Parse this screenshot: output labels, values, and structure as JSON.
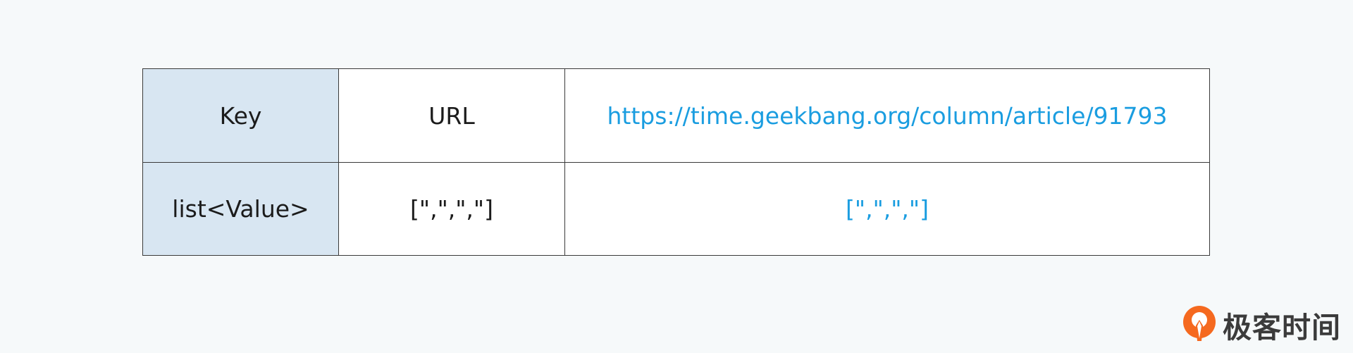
{
  "table": {
    "rows": [
      {
        "header": "Key",
        "middle": "URL",
        "value": "https://time.geekbang.org/column/article/91793"
      },
      {
        "header": "list<Value>",
        "middle": "[\",\",\",\"]",
        "value": "[\",\",\",\"]"
      }
    ]
  },
  "colors": {
    "header_bg": "#d8e6f2",
    "value_text": "#1a9de0",
    "page_bg": "#f6f9fa",
    "logo_orange": "#f5691f"
  },
  "watermark": {
    "icon": "geekbang-logo-icon",
    "text": "极客时间"
  }
}
